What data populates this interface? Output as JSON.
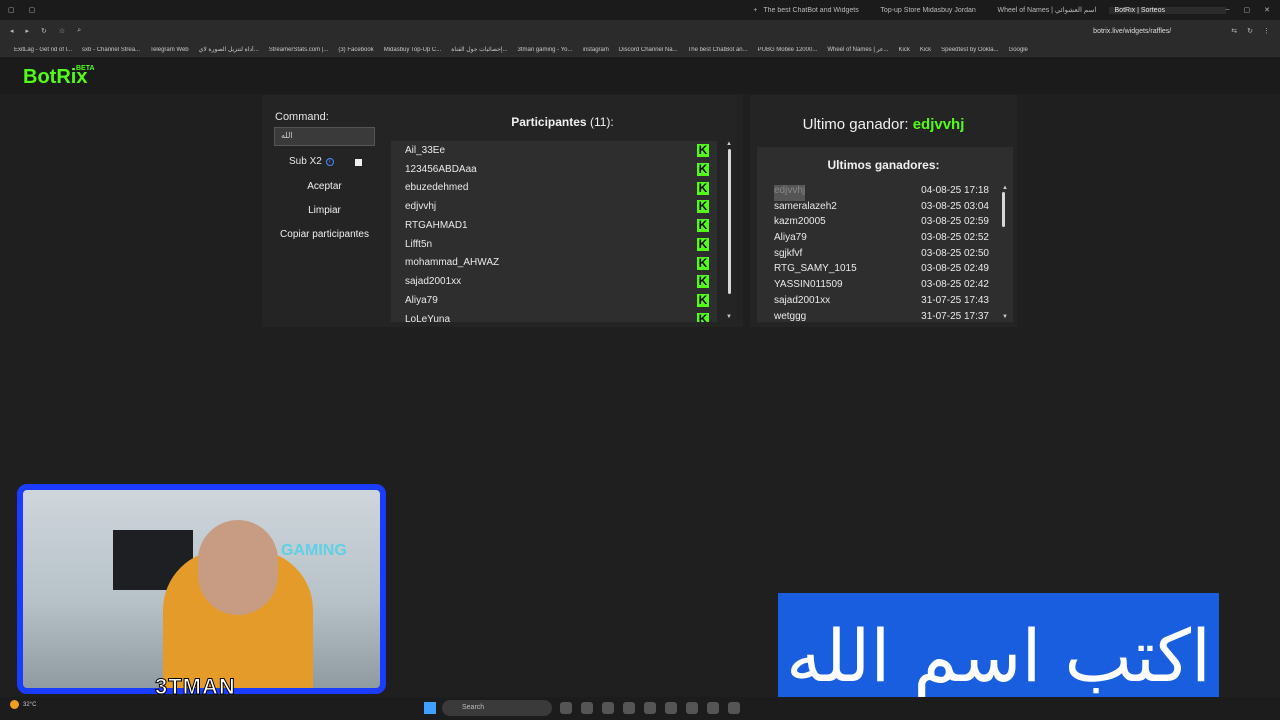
{
  "browser": {
    "tabs": [
      {
        "label": "The best ChatBot and Widgets"
      },
      {
        "label": "Top-up Store Midasbuy Jordan"
      },
      {
        "label": "Wheel of Names | اسم العشوائي"
      },
      {
        "label": "BotRix | Sorteos"
      }
    ],
    "url": "botrix.live/widgets/raffles/",
    "bookmarks": [
      "ExitLag - Get rid of l...",
      "sxb - Channel Strea...",
      "Telegram Web",
      "أداة لتنزيل الصورة لاي...",
      "StreamerStats.com |...",
      "(3) Facebook",
      "Midasbuy Top-Up C...",
      "إحصائيات جول القناة...",
      "3tman gaming - Yo...",
      "instagram",
      "Discord Channel Na...",
      "The best ChatBot an...",
      "PUBG Mobile 12000...",
      "Wheel of Names | عر...",
      "Kick",
      "Kick",
      "Speedtest by Ookla...",
      "Google"
    ]
  },
  "header": {
    "logo": "BotRix",
    "logo_badge": "BETA"
  },
  "raffle": {
    "command_label": "Command:",
    "command_value": "الله",
    "sub_label": "Sub X2",
    "buttons": {
      "accept": "Aceptar",
      "clear": "Limpiar",
      "copy": "Copiar participantes"
    },
    "participants_title": "Participantes",
    "participants_count": "(11):",
    "participants": [
      "Ail_33Ee",
      "123456ABDAaa",
      "ebuzedehmed",
      "edjvvhj",
      "RTGAHMAD1",
      "Lifft5n",
      "mohammad_AHWAZ",
      "sajad2001xx",
      "Aliya79",
      "LoLeYuna"
    ],
    "kick_icon_glyph": "K",
    "last_winner_label": "Ultimo ganador:",
    "last_winner_name": "edjvvhj",
    "winners_title": "Ultimos ganadores:",
    "winners": [
      {
        "name": "edjvvhj",
        "date": "04-08-25 17:18"
      },
      {
        "name": "sameralazeh2",
        "date": "03-08-25 03:04"
      },
      {
        "name": "kazm20005",
        "date": "03-08-25 02:59"
      },
      {
        "name": "Aliya79",
        "date": "03-08-25 02:52"
      },
      {
        "name": "sgjkfvf",
        "date": "03-08-25 02:50"
      },
      {
        "name": "RTG_SAMY_1015",
        "date": "03-08-25 02:49"
      },
      {
        "name": "YASSIN011509",
        "date": "03-08-25 02:42"
      },
      {
        "name": "sajad2001xx",
        "date": "31-07-25 17:43"
      },
      {
        "name": "wetggg",
        "date": "31-07-25 17:37"
      }
    ]
  },
  "overlay": {
    "webcam_caption": "3TMAN",
    "webcam_wall_text": "GAMING",
    "arabic_prompt": "اكتب اسم الله"
  },
  "taskbar": {
    "weather": "32°C",
    "search_placeholder": "Search"
  },
  "colors": {
    "accent": "#53fc18",
    "webcam_border": "#1a3cff",
    "overlay_bg": "#1a5ee0"
  }
}
